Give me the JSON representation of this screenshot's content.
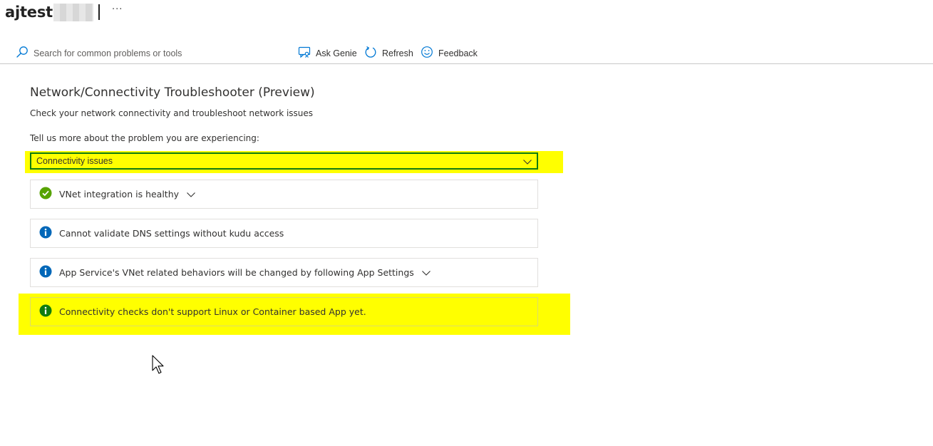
{
  "header": {
    "app_title": "ajtest",
    "more_label": "···"
  },
  "toolbar": {
    "search_placeholder": "Search for common problems or tools",
    "ask_genie_label": "Ask Genie",
    "refresh_label": "Refresh",
    "feedback_label": "Feedback"
  },
  "main": {
    "title": "Network/Connectivity Troubleshooter (Preview)",
    "subtitle": "Check your network connectivity and troubleshoot network issues",
    "prompt": "Tell us more about the problem you are experiencing:",
    "dropdown_value": "Connectivity issues",
    "results": [
      {
        "status": "success",
        "text": "VNet integration is healthy",
        "expandable": true
      },
      {
        "status": "info",
        "text": "Cannot validate DNS settings without kudu access",
        "expandable": false
      },
      {
        "status": "info",
        "text": "App Service's VNet related behaviors will be changed by following App Settings",
        "expandable": true
      },
      {
        "status": "info-green",
        "text": "Connectivity checks don't support Linux or Container based App yet.",
        "expandable": false
      }
    ]
  },
  "colors": {
    "highlight": "#ffff00",
    "accent_blue": "#0078d4",
    "success_green": "#57a300",
    "info_blue": "#0067b8",
    "info_green": "#107c10",
    "dropdown_border": "#107c10"
  }
}
